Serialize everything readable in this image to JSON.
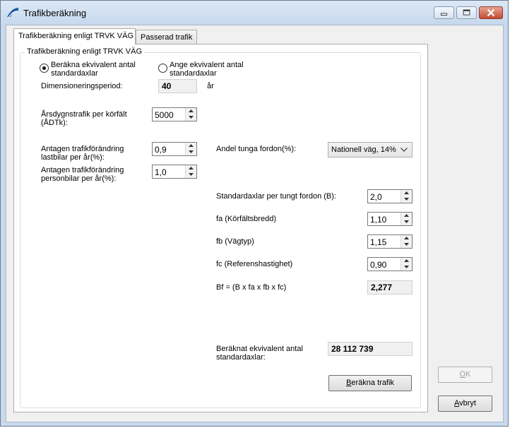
{
  "window": {
    "title": "Trafikberäkning"
  },
  "tabs": [
    {
      "label": "Trafikberäkning enligt TRVK VÄG",
      "active": true
    },
    {
      "label": "Passerad trafik",
      "active": false
    }
  ],
  "group": {
    "title": "Trafikberäkning enligt TRVK VÄG"
  },
  "mode": {
    "option1": {
      "line1": "Beräkna ekvivalent antal",
      "line2": "standardaxlar",
      "selected": true
    },
    "option2": {
      "line1": "Ange ekvivalent antal",
      "line2": "standardaxlar",
      "selected": false
    }
  },
  "period": {
    "label": "Dimensioneringsperiod:",
    "value": "40",
    "unit": "år"
  },
  "adt": {
    "label1": "Årsdygnstrafik per körfält",
    "label2": "(ÅDTk):",
    "value": "5000"
  },
  "truck_change": {
    "label1": "Antagen trafikförändring",
    "label2": "lastbilar per år(%):",
    "value": "0,9"
  },
  "car_change": {
    "label1": "Antagen trafikförändring",
    "label2": "personbilar per år(%):",
    "value": "1,0"
  },
  "heavy_share": {
    "label": "Andel tunga fordon(%):",
    "selected": "Nationell väg, 14%"
  },
  "axles": {
    "label": "Standardaxlar per tungt fordon (B):",
    "value": "2,0"
  },
  "fa": {
    "label": "fa (Körfältsbredd)",
    "value": "1,10"
  },
  "fb": {
    "label": "fb (Vägtyp)",
    "value": "1,15"
  },
  "fc": {
    "label": "fc (Referenshastighet)",
    "value": "0,90"
  },
  "bf": {
    "label": "Bf = (B x fa x fb x fc)",
    "value": "2,277"
  },
  "result": {
    "label1": "Beräknat ekvivalent antal",
    "label2": "standardaxlar:",
    "value": "28 112 739"
  },
  "buttons": {
    "calc": {
      "label_u": "B",
      "label_rest": "eräkna trafik"
    },
    "ok": {
      "label_u": "O",
      "label_rest": "K"
    },
    "cancel": {
      "label_u": "A",
      "label_rest": "vbryt"
    }
  },
  "colors": {
    "title_bar": "#c6d8ee",
    "close_button": "#c74a32",
    "client_bg": "#f0f0f0"
  },
  "icons": [
    "app-icon",
    "minimize-icon",
    "maximize-icon",
    "close-icon",
    "chevron-down-icon",
    "spin-up-icon",
    "spin-down-icon"
  ]
}
